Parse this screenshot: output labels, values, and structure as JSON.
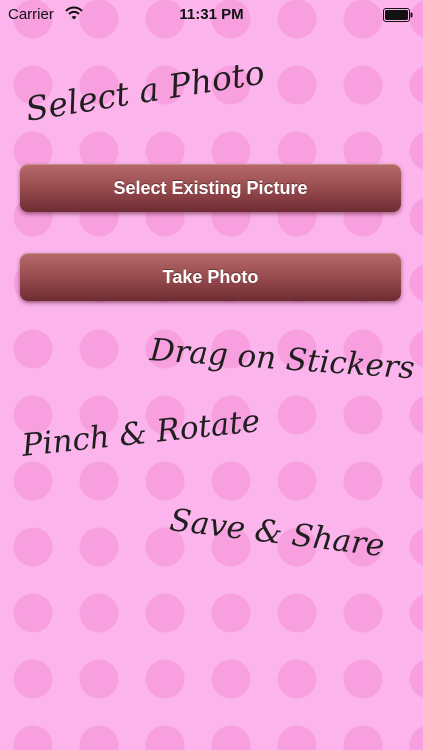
{
  "status_bar": {
    "carrier": "Carrier",
    "time": "11:31 PM",
    "wifi_icon": "wifi-icon",
    "battery_icon": "battery-full-icon"
  },
  "main": {
    "heading": "Select a Photo",
    "select_existing_label": "Select Existing Picture",
    "take_photo_label": "Take Photo",
    "captions": {
      "drag": "Drag on Stickers",
      "pinch": "Pinch & Rotate",
      "save": "Save & Share"
    }
  },
  "colors": {
    "background": "#fcb5ec",
    "polka_dot": "#f79fdf",
    "button_top": "#b76a6a",
    "button_bottom": "#6e2c33",
    "button_text": "#ffffff"
  }
}
